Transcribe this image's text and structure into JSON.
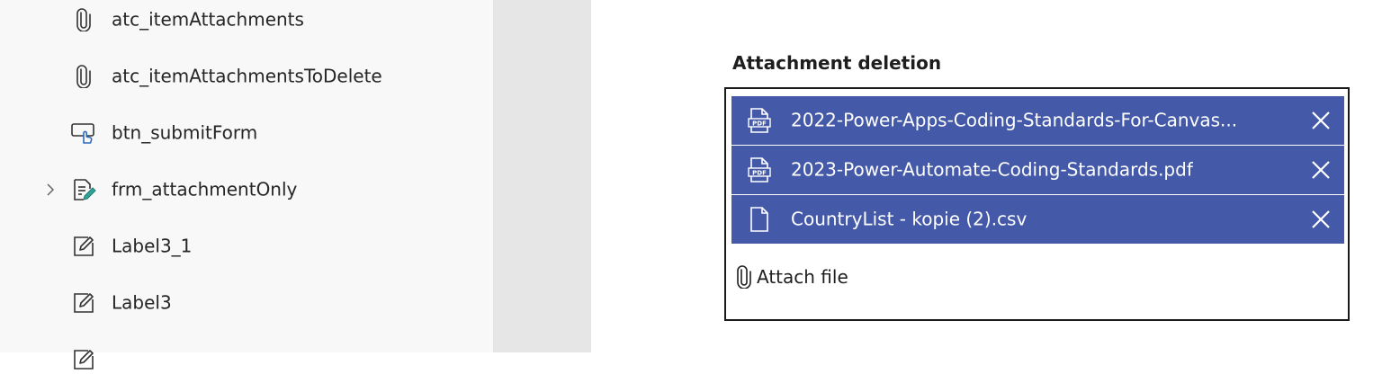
{
  "tree": {
    "items": [
      {
        "label": "atc_itemAttachments",
        "icon": "paperclip-icon",
        "expandable": false
      },
      {
        "label": "atc_itemAttachmentsToDelete",
        "icon": "paperclip-icon",
        "expandable": false
      },
      {
        "label": "btn_submitForm",
        "icon": "button-icon",
        "expandable": false
      },
      {
        "label": "frm_attachmentOnly",
        "icon": "form-icon",
        "expandable": true
      },
      {
        "label": "Label3_1",
        "icon": "label-icon",
        "expandable": false
      },
      {
        "label": "Label3",
        "icon": "label-icon",
        "expandable": false
      }
    ]
  },
  "canvas": {
    "section_title": "Attachment deletion",
    "attachments": [
      {
        "name": "2022-Power-Apps-Coding-Standards-For-Canvas...",
        "type": "pdf"
      },
      {
        "name": "2023-Power-Automate-Coding-Standards.pdf",
        "type": "pdf"
      },
      {
        "name": "CountryList - kopie (2).csv",
        "type": "file"
      }
    ],
    "attach_label": "Attach file"
  },
  "colors": {
    "panel_bg": "#f8f8f8",
    "gutter_bg": "#e6e6e6",
    "attachment_row_bg": "#4459a8",
    "text": "#252525"
  }
}
